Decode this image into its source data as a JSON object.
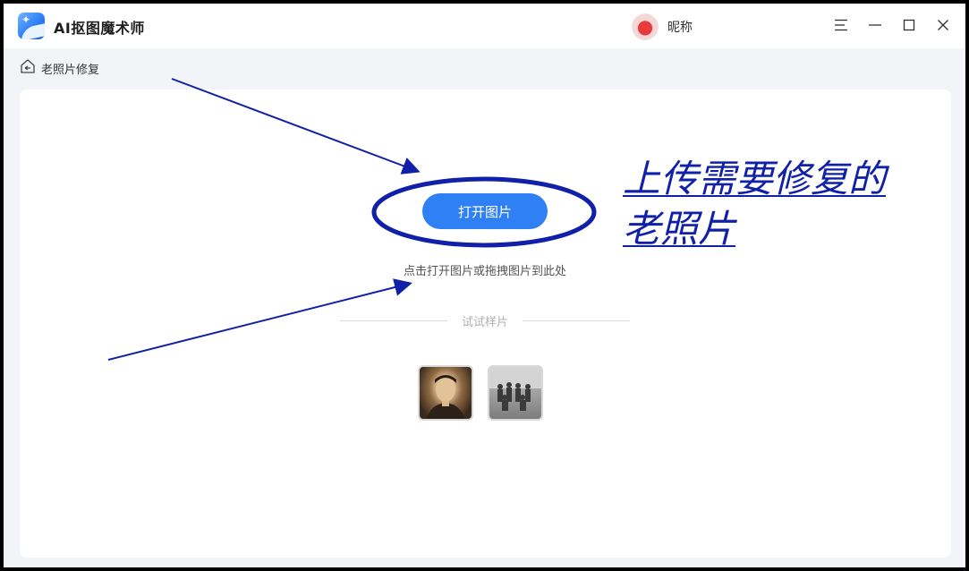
{
  "app": {
    "title": "AI抠图魔术师",
    "nickname": "昵称"
  },
  "breadcrumb": {
    "label": "老照片修复"
  },
  "upload": {
    "open_button_label": "打开图片",
    "hint": "点击打开图片或拖拽图片到此处",
    "samples_label": "试试样片"
  },
  "annotation": {
    "text": "上传需要修复的老照片",
    "color": "#1020a8"
  },
  "colors": {
    "accent": "#2f7ff5",
    "annotation": "#1020a8"
  },
  "icons": {
    "menu": "menu-icon",
    "minimize": "minimize-icon",
    "maximize": "maximize-icon",
    "close": "close-icon",
    "home": "home-icon"
  }
}
